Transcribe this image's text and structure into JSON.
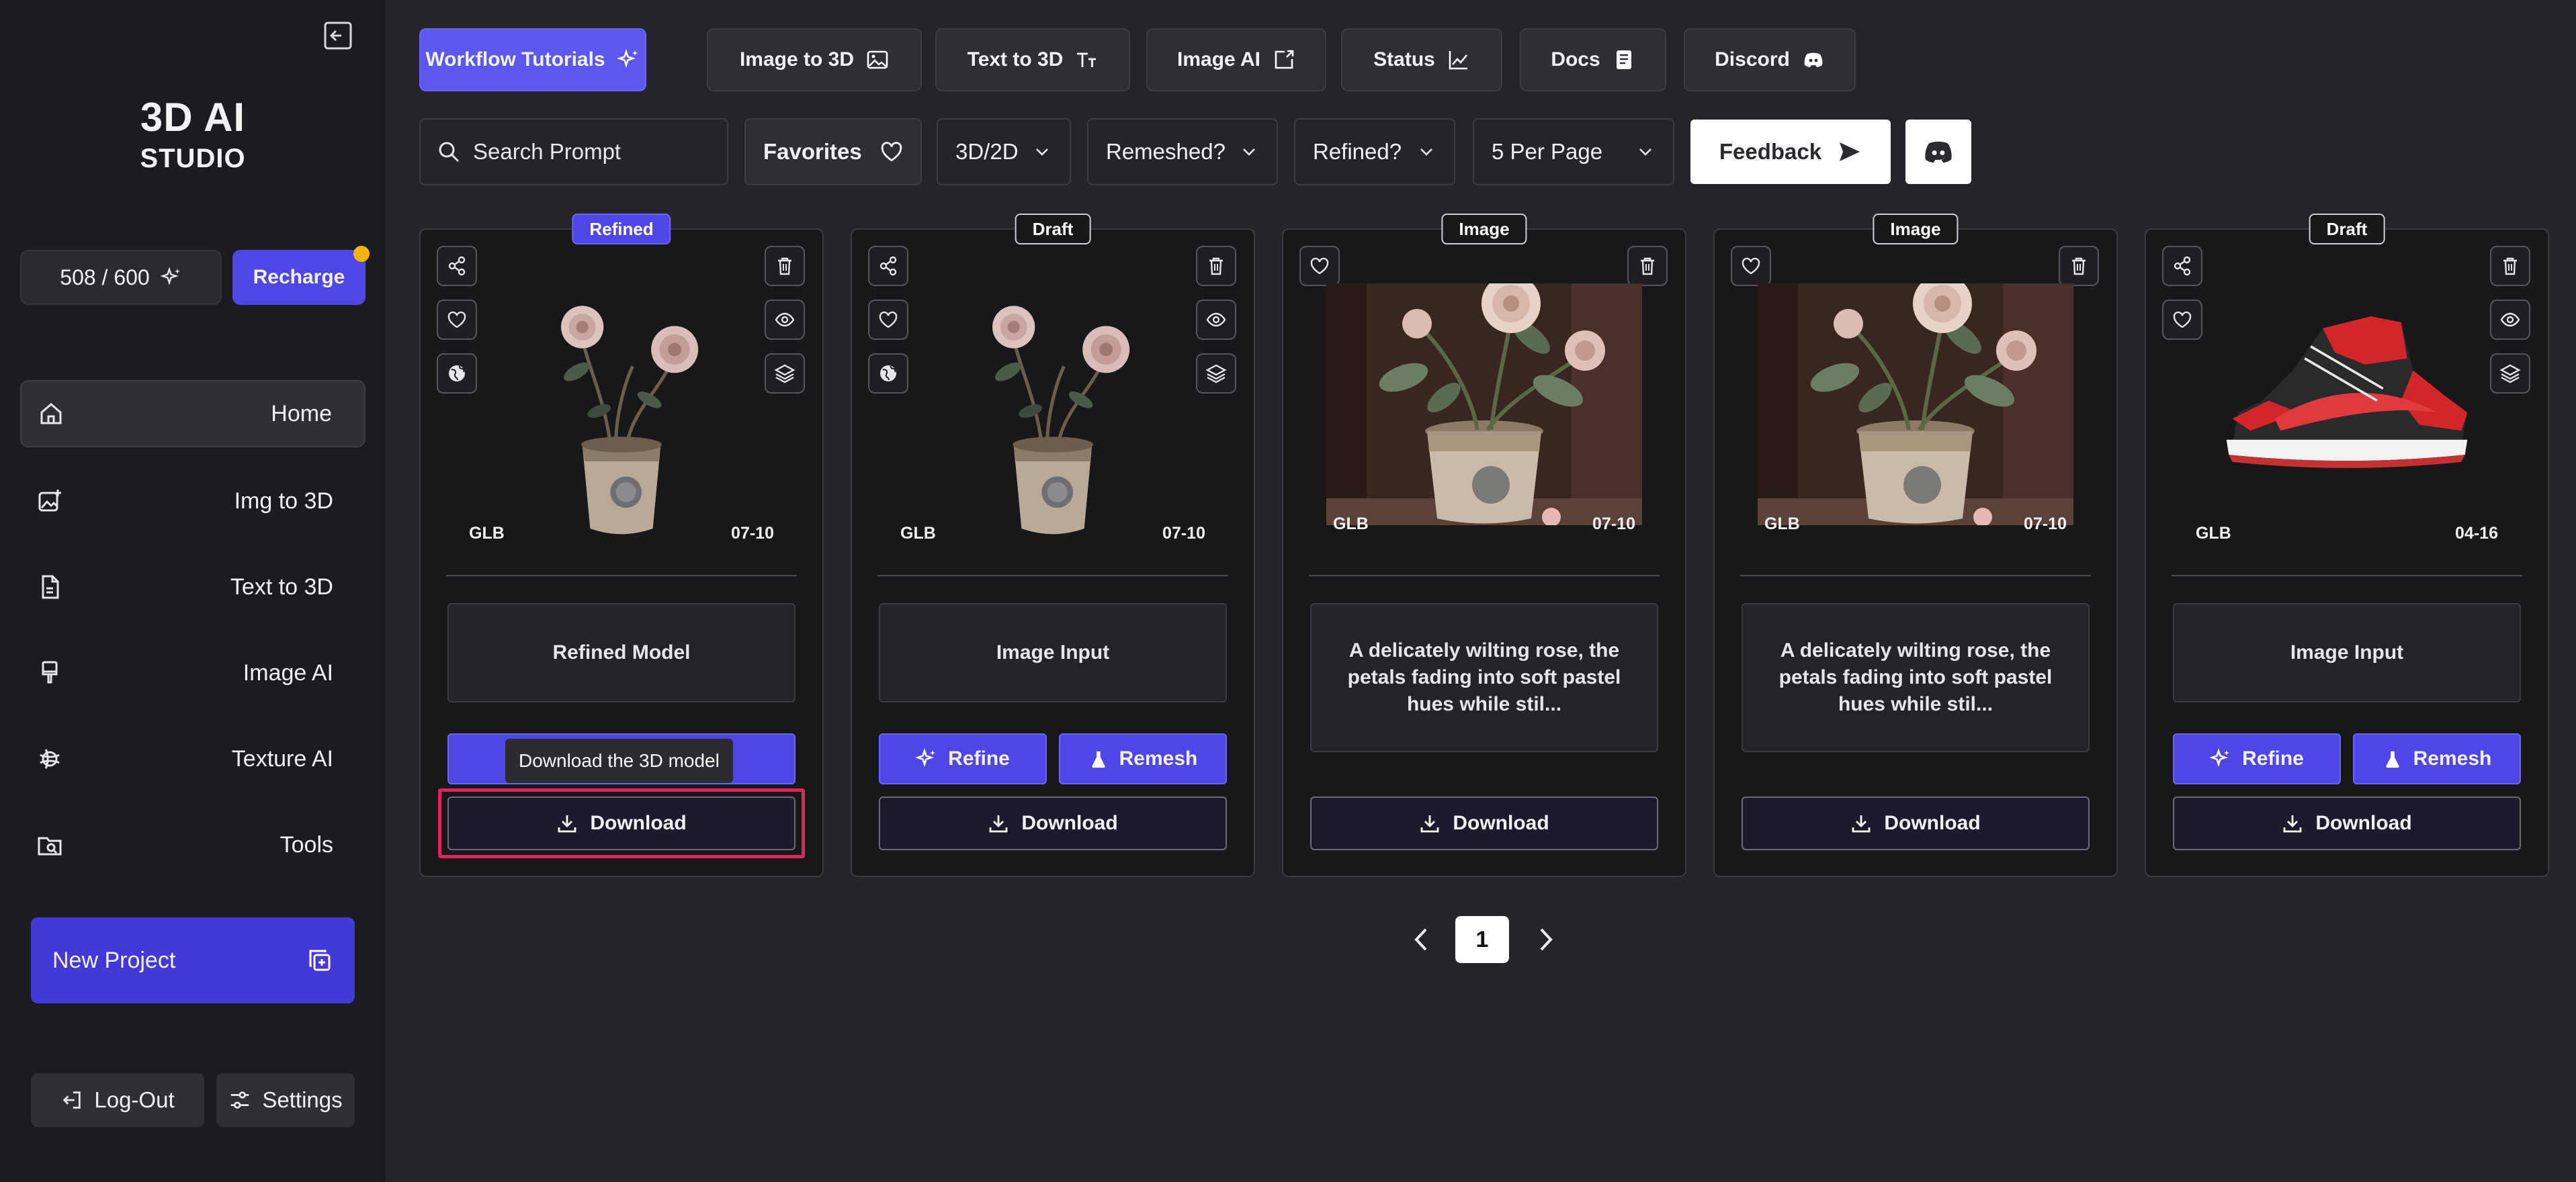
{
  "brand": {
    "line1": "3D AI",
    "line2": "STUDIO"
  },
  "credits": {
    "text": "508 / 600"
  },
  "recharge": {
    "label": "Recharge"
  },
  "nav": [
    {
      "label": "Home",
      "icon": "home-icon",
      "active": true
    },
    {
      "label": "Img to 3D",
      "icon": "image-plus-icon"
    },
    {
      "label": "Text to 3D",
      "icon": "file-text-icon"
    },
    {
      "label": "Image AI",
      "icon": "brush-icon"
    },
    {
      "label": "Texture AI",
      "icon": "texture-icon"
    },
    {
      "label": "Tools",
      "icon": "folder-search-icon"
    }
  ],
  "new_project": {
    "label": "New Project"
  },
  "logout": {
    "label": "Log-Out"
  },
  "settings": {
    "label": "Settings"
  },
  "top_tabs": [
    {
      "label": "Workflow Tutorials",
      "icon": "sparkles-icon"
    },
    {
      "label": "Image to 3D",
      "icon": "image-icon"
    },
    {
      "label": "Text to 3D",
      "icon": "text-size-icon"
    },
    {
      "label": "Image AI",
      "icon": "image-export-icon"
    },
    {
      "label": "Status",
      "icon": "chart-icon"
    },
    {
      "label": "Docs",
      "icon": "book-icon"
    },
    {
      "label": "Discord",
      "icon": "discord-icon"
    }
  ],
  "search": {
    "placeholder": "Search Prompt"
  },
  "filters": {
    "favorites": "Favorites",
    "type": "3D/2D",
    "remeshed": "Remeshed?",
    "refined": "Refined?",
    "per_page": "5 Per Page"
  },
  "feedback": {
    "label": "Feedback"
  },
  "cards": [
    {
      "badge": "Refined",
      "format": "GLB",
      "date": "07-10",
      "desc": "Refined Model",
      "download": "Download",
      "tooltip": "Download the 3D model",
      "thumb": "rose-pot"
    },
    {
      "badge": "Draft",
      "format": "GLB",
      "date": "07-10",
      "desc": "Image Input",
      "refine": "Refine",
      "remesh": "Remesh",
      "download": "Download",
      "thumb": "rose-pot"
    },
    {
      "badge": "Image",
      "format": "GLB",
      "date": "07-10",
      "desc": "A delicately wilting rose, the petals fading into soft pastel hues while stil...",
      "download": "Download",
      "thumb": "rose-photo"
    },
    {
      "badge": "Image",
      "format": "GLB",
      "date": "07-10",
      "desc": "A delicately wilting rose, the petals fading into soft pastel hues while stil...",
      "download": "Download",
      "thumb": "rose-photo"
    },
    {
      "badge": "Draft",
      "format": "GLB",
      "date": "04-16",
      "desc": "Image Input",
      "refine": "Refine",
      "remesh": "Remesh",
      "download": "Download",
      "thumb": "sneaker"
    }
  ],
  "pagination": {
    "current": "1"
  },
  "colors": {
    "accent": "#4f46e5",
    "highlight": "#e0245e",
    "notify": "#f5b40b"
  }
}
